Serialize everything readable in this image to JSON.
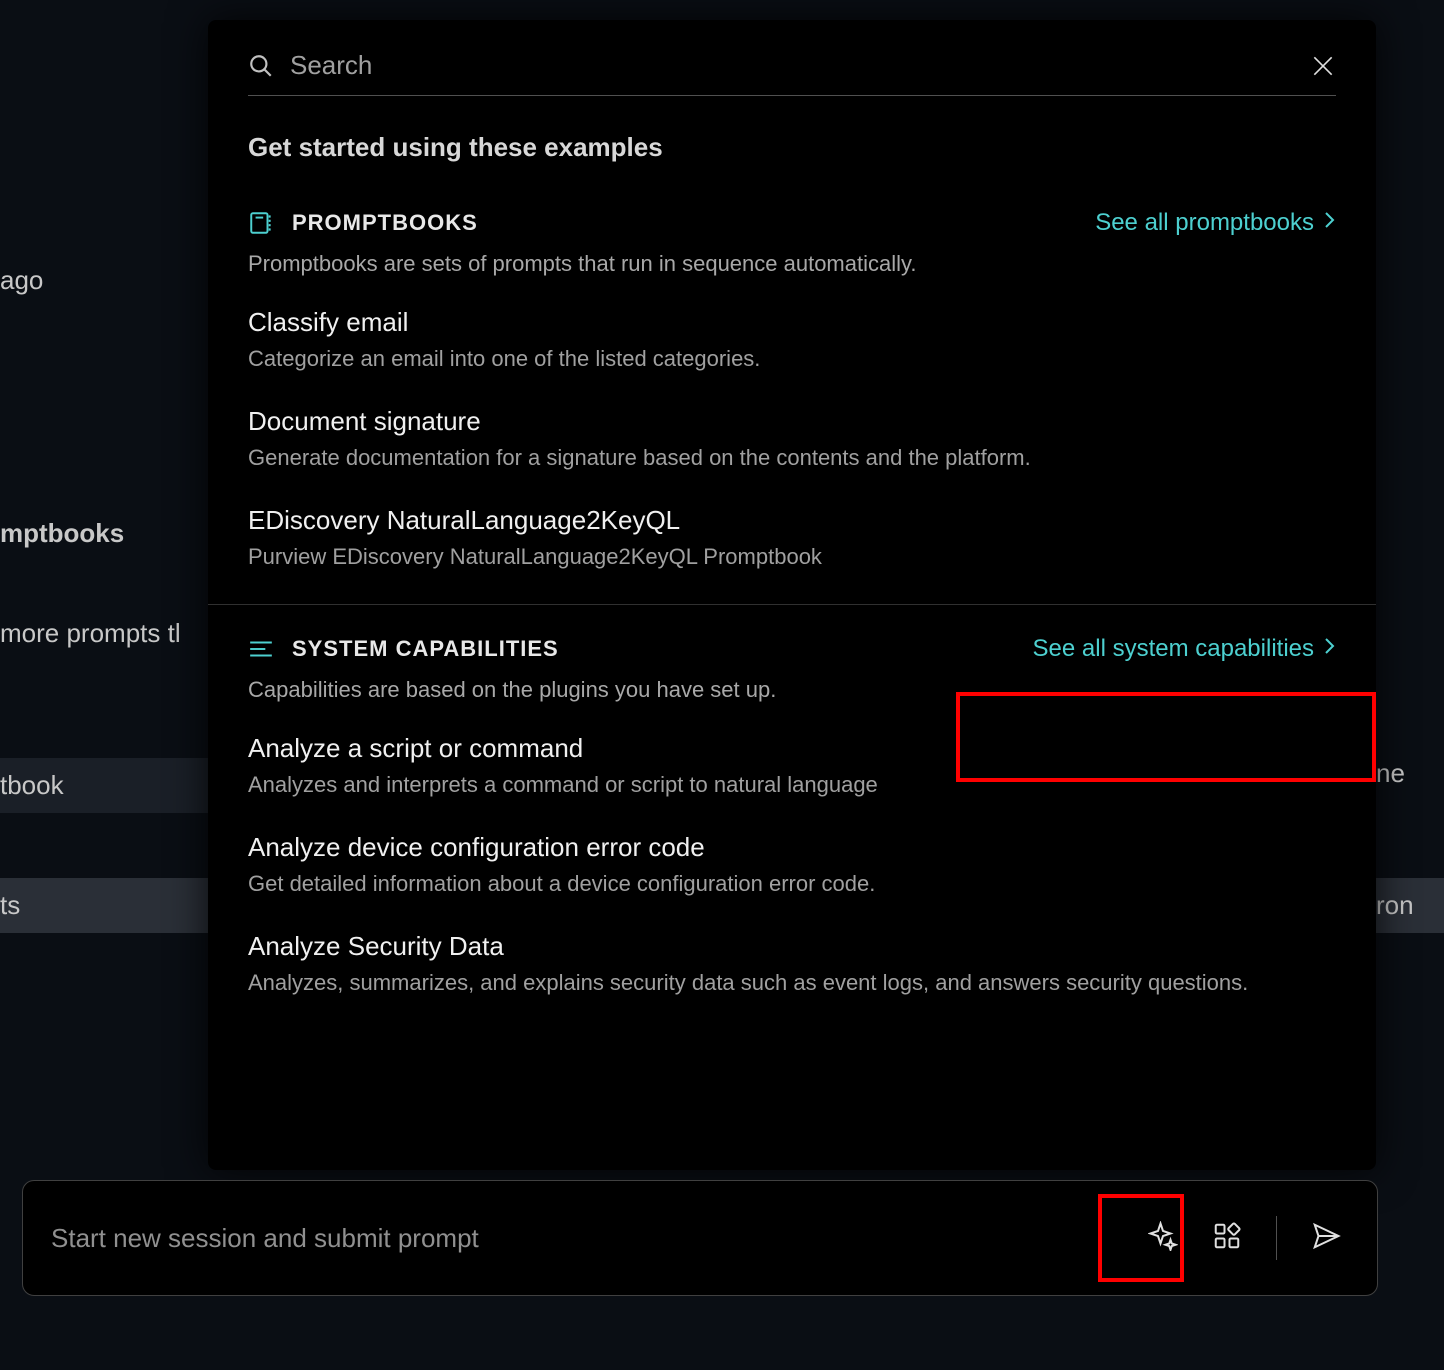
{
  "background": {
    "ago": "ago",
    "mptbooks": "mptbooks",
    "moreprompts": " more prompts tl",
    "tbook": "tbook",
    "ts": "ts",
    "ne": "ne",
    "ron": "ron"
  },
  "popup": {
    "search_placeholder": "Search",
    "subtitle": "Get started using these examples",
    "promptbooks": {
      "label": "PROMPTBOOKS",
      "see_all": "See all promptbooks",
      "desc": "Promptbooks are sets of prompts that run in sequence automatically.",
      "items": [
        {
          "title": "Classify email",
          "desc": "Categorize an email into one of the listed categories."
        },
        {
          "title": "Document signature",
          "desc": "Generate documentation for a signature based on the contents and the platform."
        },
        {
          "title": "EDiscovery NaturalLanguage2KeyQL",
          "desc": "Purview EDiscovery NaturalLanguage2KeyQL Promptbook"
        }
      ]
    },
    "capabilities": {
      "label": "SYSTEM CAPABILITIES",
      "see_all": "See all system capabilities",
      "desc": "Capabilities are based on the plugins you have set up.",
      "items": [
        {
          "title": "Analyze a script or command",
          "desc": "Analyzes and interprets a command or script to natural language"
        },
        {
          "title": "Analyze device configuration error code",
          "desc": "Get detailed information about a device configuration error code."
        },
        {
          "title": "Analyze Security Data",
          "desc": "Analyzes, summarizes, and explains security data such as event logs, and answers security questions."
        }
      ]
    }
  },
  "prompt_bar": {
    "placeholder": "Start new session and submit prompt"
  }
}
